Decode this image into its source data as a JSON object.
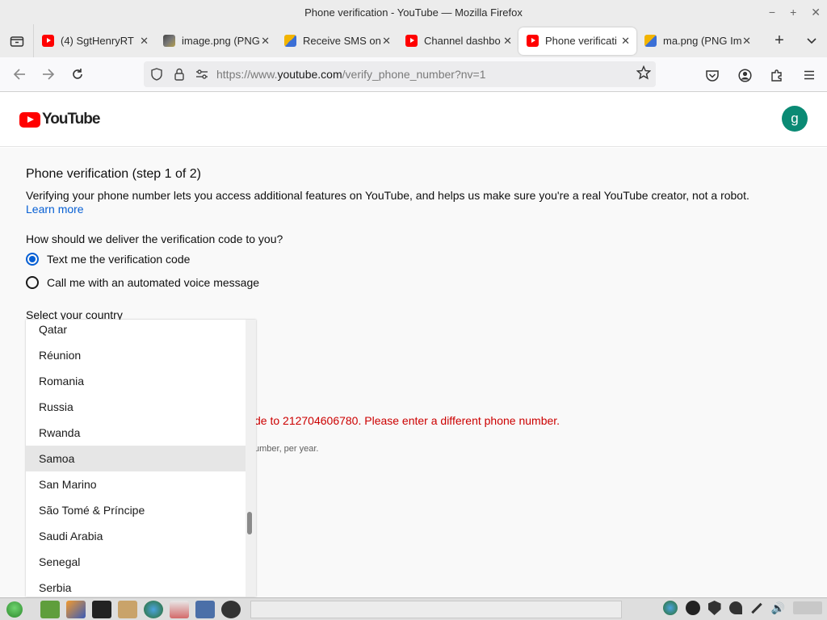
{
  "window": {
    "title": "Phone verification - YouTube — Mozilla Firefox",
    "controls": [
      "−",
      "+",
      "✕"
    ]
  },
  "tabs": [
    {
      "title": "(4) SgtHenryRT",
      "favicon": "youtube-icon",
      "active": false
    },
    {
      "title": "image.png (PNG",
      "favicon": "image-icon",
      "active": false
    },
    {
      "title": "Receive SMS on",
      "favicon": "sms-site-icon",
      "active": false
    },
    {
      "title": "Channel dashbo",
      "favicon": "youtube-icon",
      "active": false
    },
    {
      "title": "Phone verificati",
      "favicon": "youtube-icon",
      "active": true
    },
    {
      "title": "ma.png (PNG Im",
      "favicon": "sms-site-icon",
      "active": false
    }
  ],
  "urlbar": {
    "prefix": "https://www.",
    "domain": "youtube.com",
    "path": "/verify_phone_number?nv=1"
  },
  "youtube": {
    "logo_text": "YouTube",
    "avatar_letter": "g",
    "avatar_color": "#0a8a74"
  },
  "page": {
    "heading": "Phone verification (step 1 of 2)",
    "description": "Verifying your phone number lets you access additional features on YouTube, and helps us make sure you're a real YouTube creator, not a robot.",
    "learn_more": "Learn more",
    "delivery_question": "How should we deliver the verification code to you?",
    "option_text": "Text me the verification code",
    "option_call": "Call me with an automated voice message",
    "selected_option": "text",
    "country_label": "Select your country",
    "error_partial": "de to 212704606780. Please enter a different phone number.",
    "note_partial": "umber, per year."
  },
  "country_dropdown": {
    "items": [
      "Qatar",
      "Réunion",
      "Romania",
      "Russia",
      "Rwanda",
      "Samoa",
      "San Marino",
      "São Tomé & Príncipe",
      "Saudi Arabia",
      "Senegal",
      "Serbia"
    ],
    "highlighted": "Samoa"
  },
  "colors": {
    "accent_blue": "#065fd4",
    "error_red": "#cc0000",
    "youtube_red": "#ff0000"
  }
}
